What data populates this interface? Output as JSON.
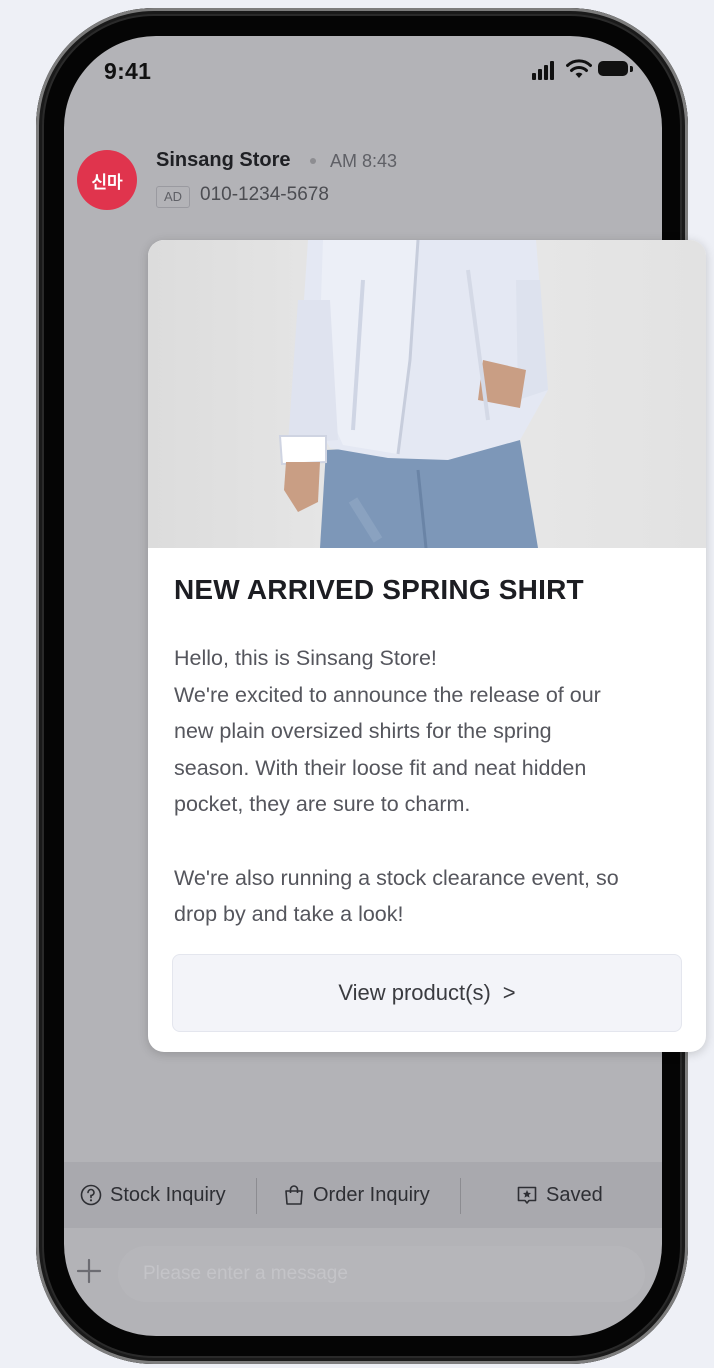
{
  "status_bar": {
    "time": "9:41"
  },
  "chat": {
    "avatar_text": "신마",
    "sender_name": "Sinsang Store",
    "sent_time": "AM 8:43",
    "ad_label": "AD",
    "phone_number": "010-1234-5678"
  },
  "message": {
    "title": "NEW ARRIVED SPRING SHIRT",
    "body_lines": [
      "Hello, this is Sinsang Store!",
      "We're excited to announce the release of our",
      "new plain oversized shirts for the spring",
      "season. With their loose fit and neat hidden",
      "pocket, they are sure to charm.",
      "We're also running a stock clearance event, so",
      "drop by and take a look!"
    ],
    "button_label": "View product(s)",
    "button_chevron": ">"
  },
  "quick_replies": [
    {
      "label": "Stock Inquiry",
      "icon": "question-circle-icon"
    },
    {
      "label": "Order Inquiry",
      "icon": "shopping-bag-icon"
    },
    {
      "label": "Saved",
      "icon": "star-bookmark-icon"
    }
  ],
  "input": {
    "placeholder": "Please enter a message"
  },
  "colors": {
    "avatar": "#e0344d",
    "screen_overlay": "#b3b3b7",
    "card_bg": "#ffffff",
    "button_bg": "#f3f4f9"
  }
}
